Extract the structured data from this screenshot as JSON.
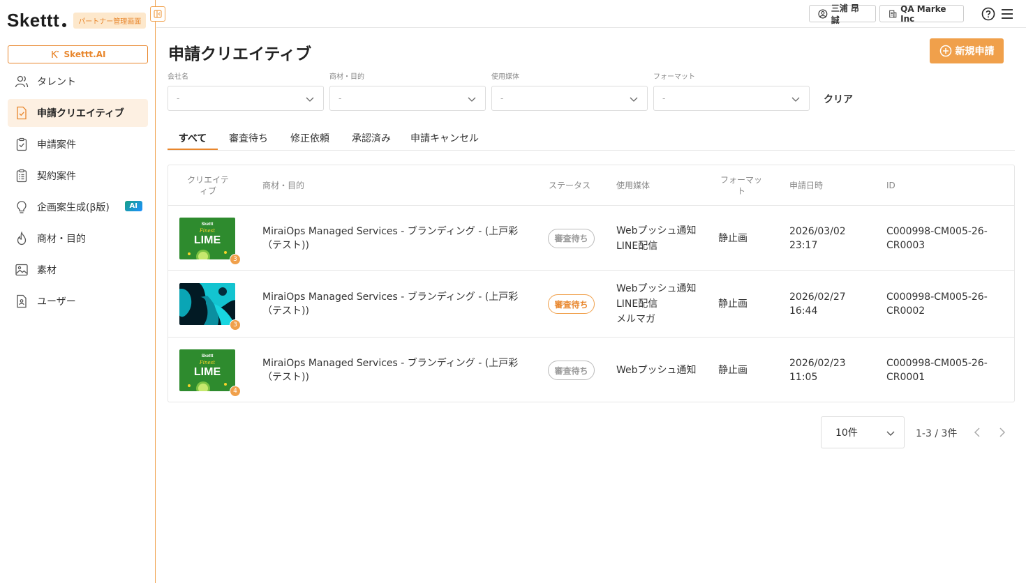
{
  "brand": {
    "logo": "Skettt",
    "badge": "パートナー管理画面",
    "ai_button": "Skettt.AI"
  },
  "sidebar": {
    "items": [
      {
        "label": "タレント",
        "icon": "users-icon",
        "active": false
      },
      {
        "label": "申請クリエイティブ",
        "icon": "document-check-icon",
        "active": true
      },
      {
        "label": "申請案件",
        "icon": "clipboard-check-icon",
        "active": false
      },
      {
        "label": "契約案件",
        "icon": "clipboard-list-icon",
        "active": false
      },
      {
        "label": "企画案生成(β版)",
        "icon": "lightbulb-icon",
        "active": false,
        "tag": "AI"
      },
      {
        "label": "商材・目的",
        "icon": "flame-icon",
        "active": false
      },
      {
        "label": "素材",
        "icon": "image-icon",
        "active": false
      },
      {
        "label": "ユーザー",
        "icon": "id-card-icon",
        "active": false
      }
    ]
  },
  "header": {
    "user": "三浦 昂誠",
    "company": "QA Marke Inc"
  },
  "main": {
    "title": "申請クリエイティブ",
    "new_button": "新規申請",
    "filters": [
      {
        "label": "会社名",
        "value": "-"
      },
      {
        "label": "商材・目的",
        "value": "-"
      },
      {
        "label": "使用媒体",
        "value": "-"
      },
      {
        "label": "フォーマット",
        "value": "-"
      }
    ],
    "clear": "クリア",
    "tabs": [
      "すべて",
      "審査待ち",
      "修正依頼",
      "承認済み",
      "申請キャンセル"
    ],
    "active_tab": 0,
    "table": {
      "headers": {
        "creative": "クリエイティブ",
        "product": "商材・目的",
        "status": "ステータス",
        "media": "使用媒体",
        "format": "フォーマット",
        "date": "申請日時",
        "id": "ID"
      },
      "rows": [
        {
          "thumb": "lime",
          "count": "3",
          "product": "MiraiOps Managed Services - ブランディング - (上戸彩（テスト))",
          "status": "審査待ち",
          "status_color": "grey",
          "media": [
            "Webプッシュ通知",
            "LINE配信"
          ],
          "format": "静止画",
          "date": "2026/03/02",
          "time": "23:17",
          "id1": "C000998-CM005-26-",
          "id2": "CR0003"
        },
        {
          "thumb": "abstract",
          "count": "3",
          "product": "MiraiOps Managed Services - ブランディング - (上戸彩（テスト))",
          "status": "審査待ち",
          "status_color": "orange",
          "media": [
            "Webプッシュ通知",
            "LINE配信",
            "メルマガ"
          ],
          "format": "静止画",
          "date": "2026/02/27",
          "time": "16:44",
          "id1": "C000998-CM005-26-",
          "id2": "CR0002"
        },
        {
          "thumb": "lime",
          "count": "4",
          "product": "MiraiOps Managed Services - ブランディング - (上戸彩（テスト))",
          "status": "審査待ち",
          "status_color": "grey",
          "media": [
            "Webプッシュ通知"
          ],
          "format": "静止画",
          "date": "2026/02/23",
          "time": "11:05",
          "id1": "C000998-CM005-26-",
          "id2": "CR0001"
        }
      ]
    },
    "thumb_text": {
      "brand": "Skettt",
      "script": "Finest",
      "word": "LIME"
    },
    "pagination": {
      "per_page": "10件",
      "info": "1-3 / 3件"
    }
  },
  "colors": {
    "accent": "#f0a04b",
    "accent_dark": "#e8862c",
    "active_bg": "#fdf0e2"
  }
}
